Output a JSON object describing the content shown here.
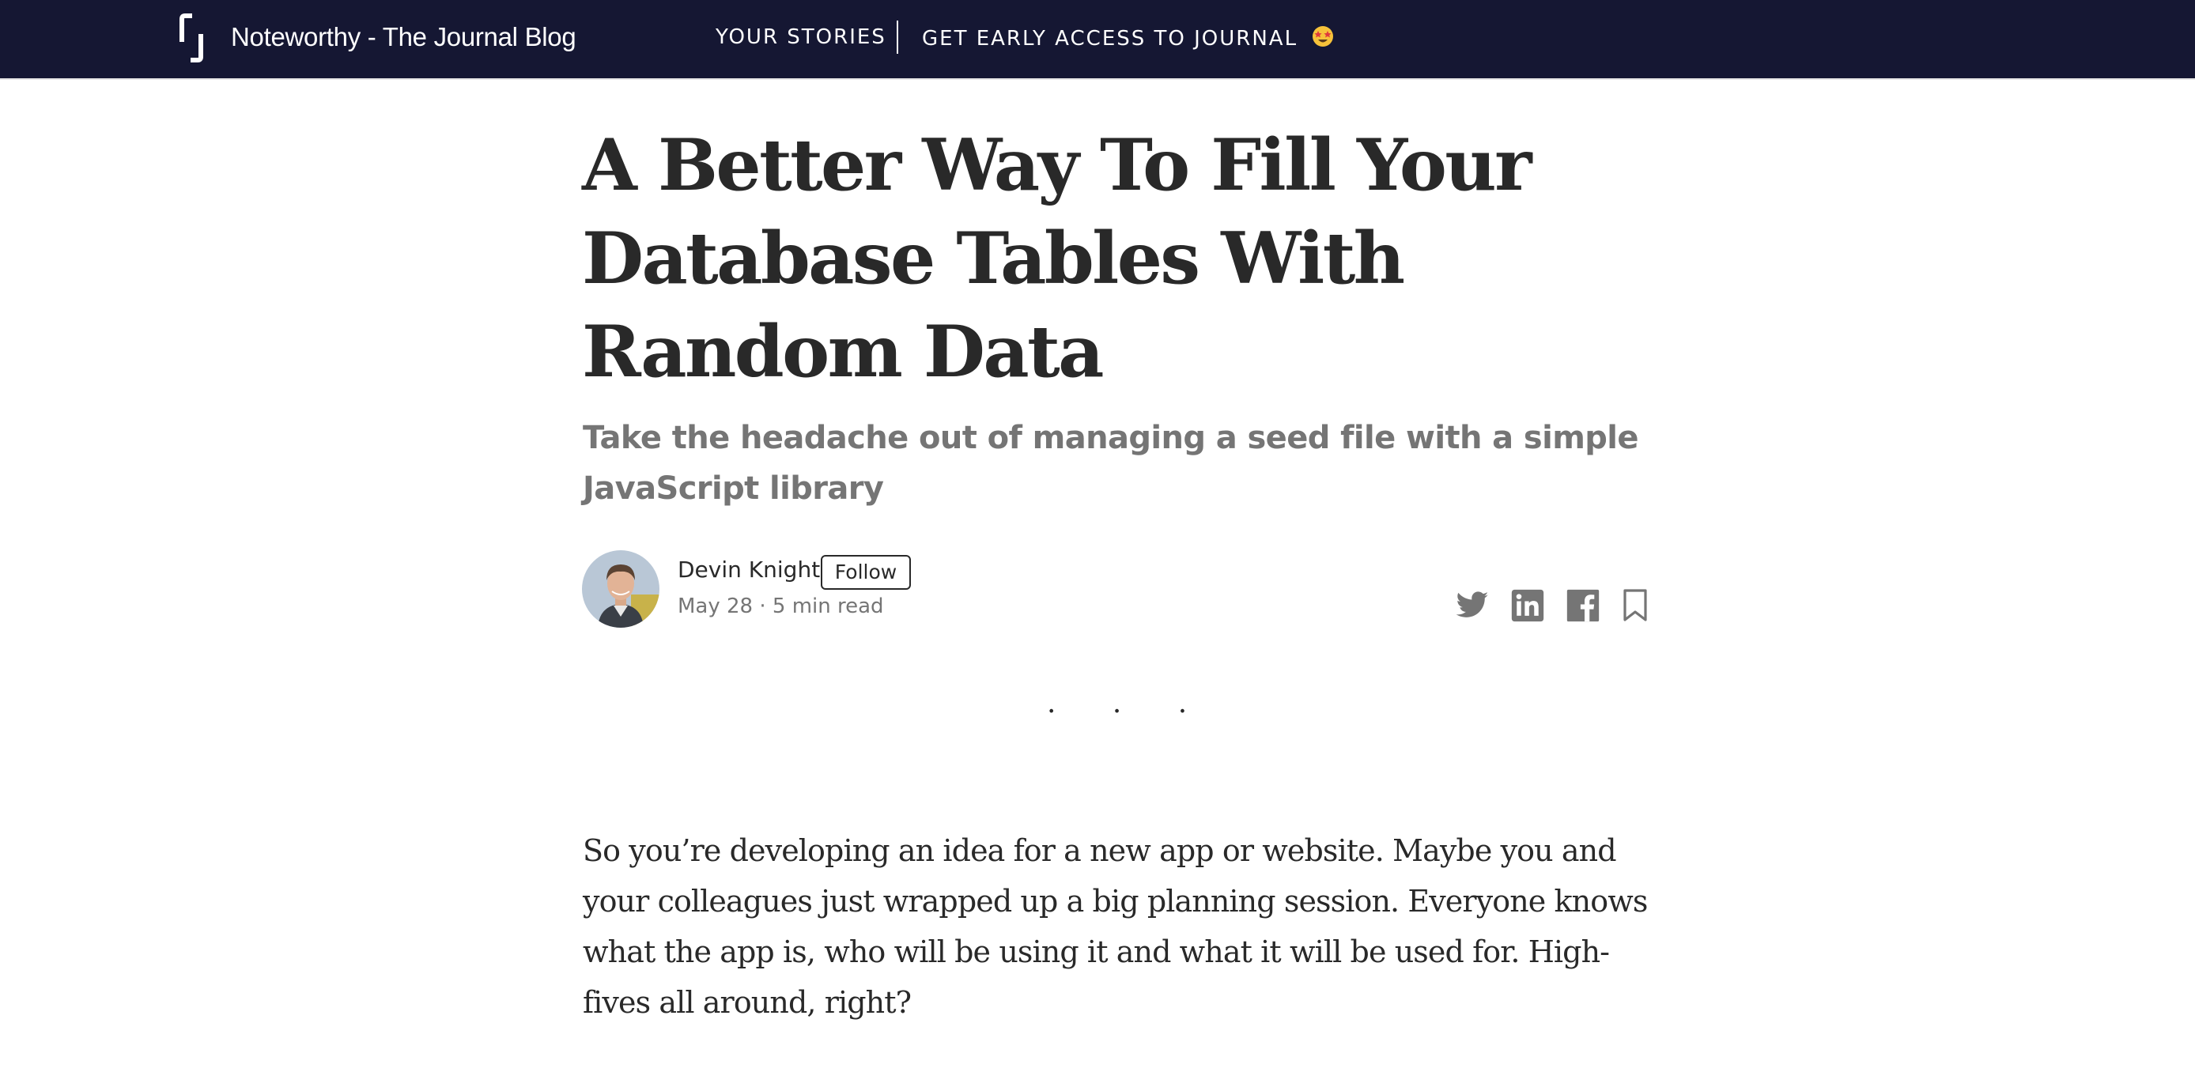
{
  "header": {
    "brand_name": "Noteworthy - The Journal Blog",
    "logo_icon": "journal-bracket-logo",
    "nav": {
      "your_stories": "YOUR STORIES",
      "early_access": "GET EARLY ACCESS TO JOURNAL",
      "early_access_emoji": "star-struck-emoji"
    },
    "background_color": "#151733"
  },
  "article": {
    "title": "A Better Way To Fill Your Database Tables With Random Data",
    "subtitle": "Take the headache out of managing a seed file with a simple JavaScript library",
    "author": {
      "name": "Devin Knight",
      "follow_label": "Follow",
      "meta": "May 28 · 5 min read"
    },
    "share": {
      "twitter_icon": "twitter-icon",
      "linkedin_icon": "linkedin-icon",
      "facebook_icon": "facebook-icon",
      "bookmark_icon": "bookmark-icon"
    },
    "separator": "· · ·",
    "paragraph": "So you’re developing an idea for a new app or website. Maybe you and your colleagues just wrapped up a big planning session. Everyone knows what the app is, who will be using it and what it will be used for. High-fives all around, right?"
  },
  "colors": {
    "text_primary": "#292929",
    "text_secondary": "#757575",
    "icon_gray": "#757575"
  }
}
